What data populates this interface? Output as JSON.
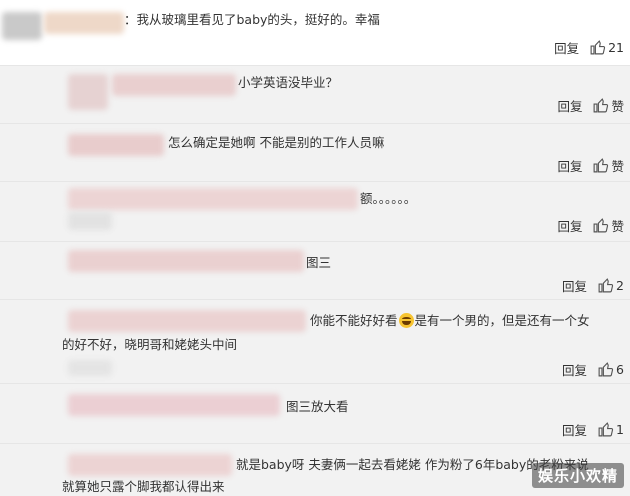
{
  "comments": [
    {
      "text": "：我从玻璃里看见了baby的头，挺好的。幸福",
      "reply": "回复",
      "like": "21"
    },
    {
      "text": "小学英语没毕业？",
      "reply": "回复",
      "like": "赞"
    },
    {
      "text": "怎么确定是她啊  不能是别的工作人员嘛",
      "reply": "回复",
      "like": "赞"
    },
    {
      "text": "额。。。。。。",
      "reply": "回复",
      "like": "赞"
    },
    {
      "text": "图三",
      "reply": "回复",
      "like": "2"
    },
    {
      "text_part1": "你能不能好好看",
      "text_part2": "是有一个男的，但是还有一个女",
      "text_line2": "的好不好，晓明哥和姥姥头中间",
      "reply": "回复",
      "like": "6"
    },
    {
      "text": "图三放大看",
      "reply": "回复",
      "like": "1"
    },
    {
      "text_line1": "就是baby呀  夫妻俩一起去看姥姥  作为粉了6年baby的老粉来说",
      "text_line2": "就算她只露个脚我都认得出来"
    }
  ],
  "emoji": "grinning-face-emoji",
  "watermark": "娱乐小欢精",
  "colors": {
    "comment_bg": "#f2f2f2",
    "top_bg": "#ffffff",
    "text": "#333333"
  }
}
